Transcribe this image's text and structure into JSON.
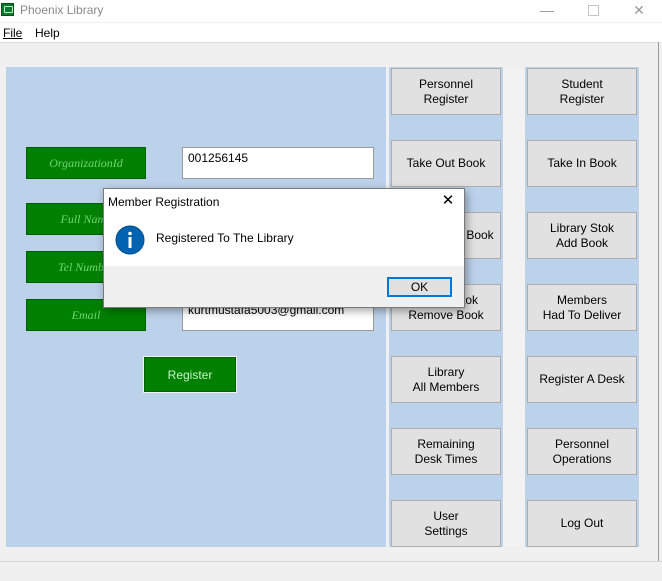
{
  "window": {
    "title": "Phoenix Library",
    "minimize_glyph": "—",
    "close_glyph": "✕"
  },
  "menu": {
    "file": "File",
    "help": "Help"
  },
  "form": {
    "org_label": "OrganizationId",
    "org_value": "001256145",
    "fullname_label": "Full Name",
    "tel_label": "Tel Number",
    "email_label": "Email",
    "email_value": "kurtmustafa5003@gmail.com",
    "register_label": "Register"
  },
  "buttons": [
    "Personnel\nRegister",
    "Student\nRegister",
    "Take Out Book",
    "Take In Book",
    "Library Give Book",
    "Library Stok\nAdd Book",
    "Library Stok\nRemove Book",
    "Members\nHad To Deliver",
    "Library\nAll Members",
    "Register A Desk",
    "Remaining\nDesk Times",
    "Personnel\nOperations",
    "User\nSettings",
    "Log Out"
  ],
  "dialog": {
    "title": "Member Registration",
    "message": "Registered To The Library",
    "ok_label": "OK",
    "icon": "info-icon"
  },
  "colors": {
    "panel": "#bcd1ea",
    "field_green": "#008000",
    "focus_blue": "#0078d7"
  }
}
